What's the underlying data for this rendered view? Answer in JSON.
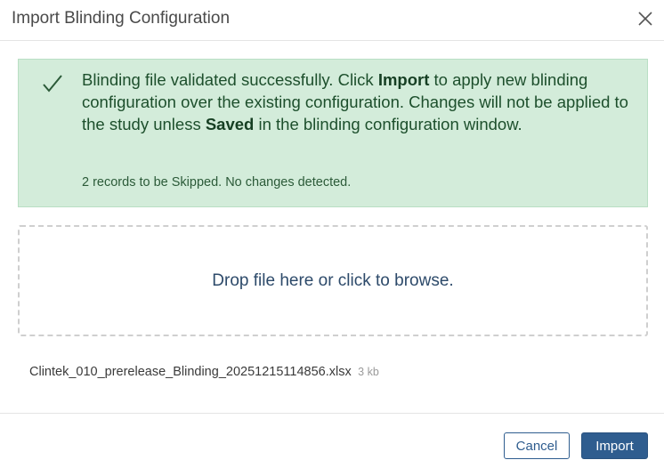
{
  "dialog": {
    "title": "Import Blinding Configuration"
  },
  "banner": {
    "icon": "check-icon",
    "message_part1": "Blinding file validated successfully. Click ",
    "message_import": "Import",
    "message_part2": " to apply new blinding configuration over the existing configuration. Changes will not be applied to the study unless ",
    "message_saved": "Saved",
    "message_part3": " in the blinding configuration window.",
    "status": "2 records to be Skipped. No changes detected.",
    "background_color": "#d3ecda"
  },
  "dropzone": {
    "label": "Drop file here or click to browse."
  },
  "file": {
    "name": "Clintek_010_prerelease_Blinding_20251215114856.xlsx",
    "size": "3 kb"
  },
  "footer": {
    "cancel_label": "Cancel",
    "import_label": "Import",
    "primary_color": "#2f5d8f"
  }
}
